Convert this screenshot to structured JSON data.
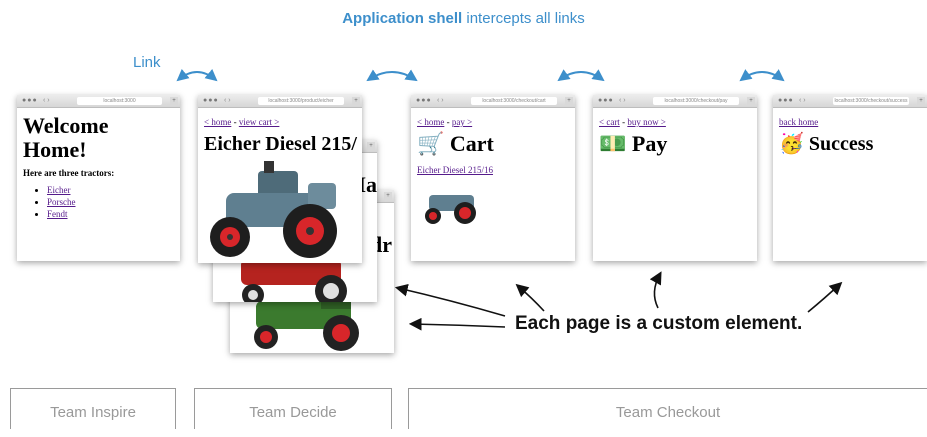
{
  "header": {
    "title_bold": "Application shell",
    "title_rest": " intercepts all links",
    "link_label": "Link"
  },
  "browser": {
    "url_home": "localhost:3000",
    "url_product": "localhost:3000/product/eicher",
    "url_cart": "localhost:3000/checkout/cart",
    "url_pay": "localhost:3000/checkout/pay",
    "url_success": "localhost:3000/checkout/success"
  },
  "page_home": {
    "heading": "Welcome Home!",
    "subheading": "Here are three tractors:",
    "items": [
      "Eicher",
      "Porsche",
      "Fendt"
    ]
  },
  "page_product": {
    "nav_home": "< home",
    "nav_sep": " - ",
    "nav_cart": "view cart >",
    "heading": "Eicher Diesel 215/",
    "back_heading_2": "Ma",
    "back_heading_3": "dr"
  },
  "page_cart": {
    "nav_home": "< home",
    "nav_sep": " - ",
    "nav_pay": "pay >",
    "heading": "Cart",
    "heading_icon": "🛒",
    "item": "Eicher Diesel 215/16"
  },
  "page_pay": {
    "nav_cart": "< cart",
    "nav_sep": " - ",
    "nav_buy": "buy now >",
    "heading": "Pay",
    "heading_icon": "💵"
  },
  "page_success": {
    "nav_back": "back home",
    "heading": "Success",
    "heading_icon": "🥳"
  },
  "callout": "Each page is a custom element.",
  "teams": {
    "inspire": "Team Inspire",
    "decide": "Team Decide",
    "checkout": "Team Checkout"
  },
  "colors": {
    "accent": "#3d8fcb",
    "tractor_blue": "#5f7f90",
    "tractor_red": "#b5231f",
    "tractor_green": "#3b7a2e",
    "wheel_red": "#d8262a"
  }
}
